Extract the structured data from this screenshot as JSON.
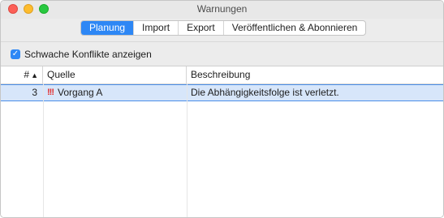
{
  "window": {
    "title": "Warnungen"
  },
  "tabs": [
    {
      "label": "Planung",
      "active": true
    },
    {
      "label": "Import",
      "active": false
    },
    {
      "label": "Export",
      "active": false
    },
    {
      "label": "Veröffentlichen & Abonnieren",
      "active": false
    }
  ],
  "filter": {
    "label": "Schwache Konflikte anzeigen",
    "checked": true
  },
  "table": {
    "headers": {
      "num": "#",
      "source": "Quelle",
      "description": "Beschreibung"
    },
    "rows": [
      {
        "num": "3",
        "priority": "!!!",
        "source": "Vorgang A",
        "description": "Die Abhängigkeitsfolge ist verletzt."
      }
    ]
  },
  "colors": {
    "accent": "#2d87f5",
    "warning": "#e23030",
    "selection": "#d7e6fa"
  }
}
